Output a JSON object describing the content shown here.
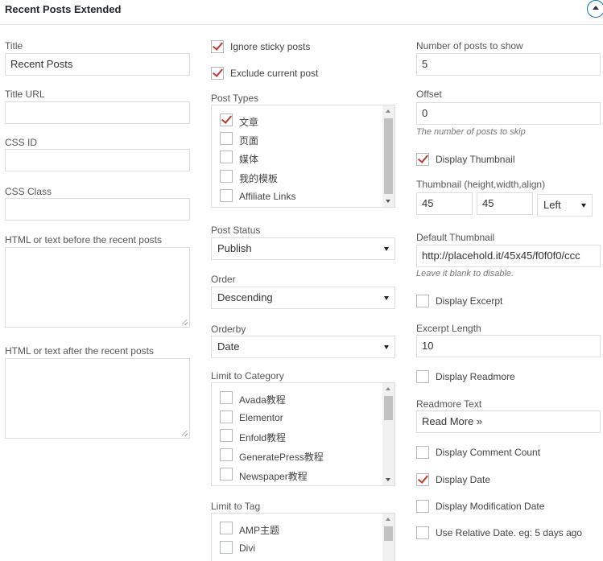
{
  "widget": {
    "title": "Recent Posts Extended"
  },
  "col1": {
    "title_label": "Title",
    "title_value": "Recent Posts",
    "title_url_label": "Title URL",
    "css_id_label": "CSS ID",
    "css_class_label": "CSS Class",
    "before_label": "HTML or text before the recent posts",
    "after_label": "HTML or text after the recent posts"
  },
  "col2": {
    "ignore_sticky": {
      "label": "Ignore sticky posts",
      "checked": true
    },
    "exclude_current": {
      "label": "Exclude current post",
      "checked": true
    },
    "post_types_label": "Post Types",
    "post_types": [
      {
        "label": "文章",
        "checked": true
      },
      {
        "label": "页面",
        "checked": false
      },
      {
        "label": "媒体",
        "checked": false
      },
      {
        "label": "我的模板",
        "checked": false
      },
      {
        "label": "Affiliate Links",
        "checked": false
      }
    ],
    "post_status_label": "Post Status",
    "post_status_value": "Publish",
    "order_label": "Order",
    "order_value": "Descending",
    "orderby_label": "Orderby",
    "orderby_value": "Date",
    "category_label": "Limit to Category",
    "categories": [
      {
        "label": "Avada教程",
        "checked": false
      },
      {
        "label": "Elementor",
        "checked": false
      },
      {
        "label": "Enfold教程",
        "checked": false
      },
      {
        "label": "GeneratePress教程",
        "checked": false
      },
      {
        "label": "Newspaper教程",
        "checked": false
      }
    ],
    "tag_label": "Limit to Tag",
    "tags": [
      {
        "label": "AMP主题",
        "checked": false
      },
      {
        "label": "Divi",
        "checked": false
      }
    ]
  },
  "col3": {
    "num_posts_label": "Number of posts to show",
    "num_posts_value": "5",
    "offset_label": "Offset",
    "offset_value": "0",
    "offset_hint": "The number of posts to skip",
    "display_thumbnail": {
      "label": "Display Thumbnail",
      "checked": true
    },
    "thumb_label": "Thumbnail (height,width,align)",
    "thumb_height": "45",
    "thumb_width": "45",
    "thumb_align": "Left",
    "default_thumb_label": "Default Thumbnail",
    "default_thumb_value": "http://placehold.it/45x45/f0f0f0/ccc",
    "default_thumb_hint": "Leave it blank to disable.",
    "display_excerpt": {
      "label": "Display Excerpt",
      "checked": false
    },
    "excerpt_length_label": "Excerpt Length",
    "excerpt_length_value": "10",
    "display_readmore": {
      "label": "Display Readmore",
      "checked": false
    },
    "readmore_text_label": "Readmore Text",
    "readmore_text_value": "Read More »",
    "display_comment_count": {
      "label": "Display Comment Count",
      "checked": false
    },
    "display_date": {
      "label": "Display Date",
      "checked": true
    },
    "display_mod_date": {
      "label": "Display Modification Date",
      "checked": false
    },
    "relative_date": {
      "label": "Use Relative Date. eg: 5 days ago",
      "checked": false
    }
  },
  "colors": {
    "check": "#c0392b",
    "border": "#dddddd",
    "accent": "#0073aa"
  }
}
